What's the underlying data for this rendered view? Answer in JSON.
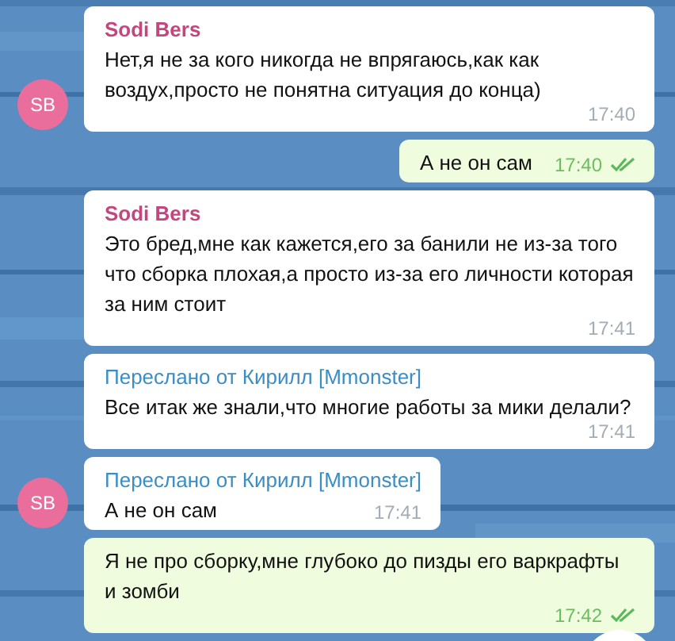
{
  "messages": [
    {
      "kind": "incoming",
      "avatar": "SB",
      "sender": "Sodi Bers",
      "text": "Нет,я не за кого никогда не впрягаюсь,как как воздух,просто не понятна ситуация до конца)",
      "time": "17:40"
    },
    {
      "kind": "outgoing",
      "text": "А не он сам",
      "time": "17:40",
      "read": true
    },
    {
      "kind": "incoming",
      "sender": "Sodi Bers",
      "text": "Это бред,мне как кажется,его за банили не из-за того что сборка плохая,а просто из-за его личности которая за ним стоит",
      "time": "17:41"
    },
    {
      "kind": "incoming",
      "forwarded": "Переслано от Кирилл [Mmonster]",
      "text": "Все итак же знали,что многие работы за мики делали?",
      "time": "17:41"
    },
    {
      "kind": "incoming",
      "avatar": "SB",
      "forwarded": "Переслано от Кирилл [Mmonster]",
      "text": "А не он сам",
      "time": "17:41"
    },
    {
      "kind": "outgoing",
      "text": "Я не про сборку,мне глубоко до пизды его варкрафты и зомби",
      "time": "17:42",
      "read": true
    }
  ]
}
